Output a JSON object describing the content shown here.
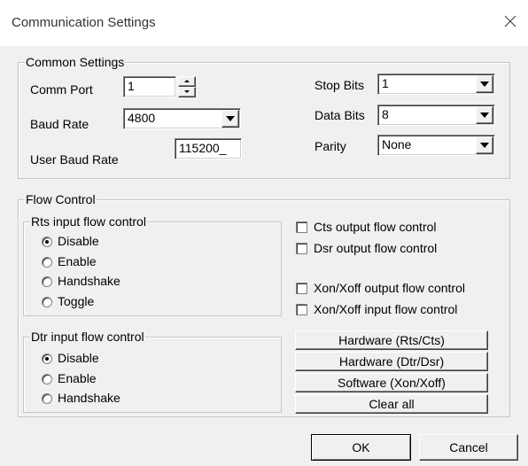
{
  "window": {
    "title": "Communication Settings",
    "close_icon": "close-icon"
  },
  "common_settings": {
    "legend": "Common Settings",
    "comm_port": {
      "label": "Comm Port",
      "value": "1"
    },
    "baud_rate": {
      "label": "Baud Rate",
      "value": "4800"
    },
    "user_baud_rate": {
      "label": "User Baud Rate",
      "value": "115200_"
    },
    "stop_bits": {
      "label": "Stop Bits",
      "value": "1"
    },
    "data_bits": {
      "label": "Data Bits",
      "value": "8"
    },
    "parity": {
      "label": "Parity",
      "value": "None"
    }
  },
  "flow_control": {
    "legend": "Flow Control",
    "rts": {
      "legend": "Rts input flow control",
      "options": [
        {
          "label": "Disable",
          "selected": true
        },
        {
          "label": "Enable",
          "selected": false
        },
        {
          "label": "Handshake",
          "selected": false
        },
        {
          "label": "Toggle",
          "selected": false
        }
      ]
    },
    "dtr": {
      "legend": "Dtr input flow control",
      "options": [
        {
          "label": "Disable",
          "selected": true
        },
        {
          "label": "Enable",
          "selected": false
        },
        {
          "label": "Handshake",
          "selected": false
        }
      ]
    },
    "checkboxes": [
      {
        "label": "Cts output flow control",
        "checked": false
      },
      {
        "label": "Dsr output flow control",
        "checked": false
      },
      {
        "label": "Xon/Xoff output flow control",
        "checked": false
      },
      {
        "label": "Xon/Xoff input flow control",
        "checked": false
      }
    ],
    "preset_buttons": [
      "Hardware (Rts/Cts)",
      "Hardware (Dtr/Dsr)",
      "Software (Xon/Xoff)",
      "Clear all"
    ]
  },
  "footer": {
    "ok": "OK",
    "cancel": "Cancel"
  }
}
